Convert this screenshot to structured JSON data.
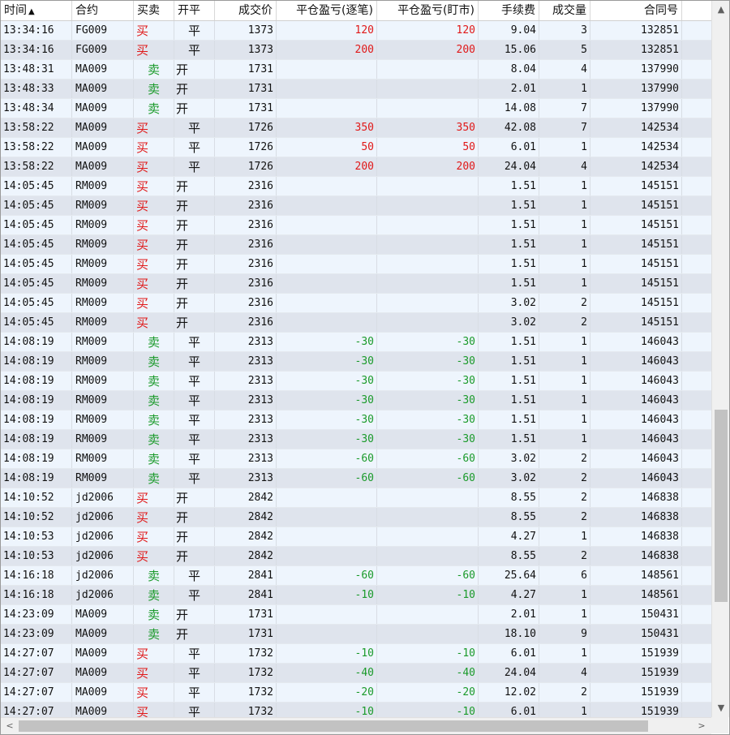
{
  "columns": {
    "time": "时间",
    "symbol": "合约",
    "direction": "买卖",
    "open_close": "开平",
    "price": "成交价",
    "pnl_trade": "平仓盈亏(逐笔)",
    "pnl_market": "平仓盈亏(盯市)",
    "fee": "手续费",
    "volume": "成交量",
    "order_no": "合同号",
    "sort_indicator": "▲"
  },
  "rows": [
    {
      "time": "13:34:16",
      "symbol": "FG009",
      "dir": "买",
      "oc": "平",
      "price": "1373",
      "pnl1": "120",
      "pnl2": "120",
      "fee": "9.04",
      "vol": "3",
      "order": "132851"
    },
    {
      "time": "13:34:16",
      "symbol": "FG009",
      "dir": "买",
      "oc": "平",
      "price": "1373",
      "pnl1": "200",
      "pnl2": "200",
      "fee": "15.06",
      "vol": "5",
      "order": "132851"
    },
    {
      "time": "13:48:31",
      "symbol": "MA009",
      "dir": "卖",
      "oc": "开",
      "price": "1731",
      "pnl1": "",
      "pnl2": "",
      "fee": "8.04",
      "vol": "4",
      "order": "137990"
    },
    {
      "time": "13:48:33",
      "symbol": "MA009",
      "dir": "卖",
      "oc": "开",
      "price": "1731",
      "pnl1": "",
      "pnl2": "",
      "fee": "2.01",
      "vol": "1",
      "order": "137990"
    },
    {
      "time": "13:48:34",
      "symbol": "MA009",
      "dir": "卖",
      "oc": "开",
      "price": "1731",
      "pnl1": "",
      "pnl2": "",
      "fee": "14.08",
      "vol": "7",
      "order": "137990"
    },
    {
      "time": "13:58:22",
      "symbol": "MA009",
      "dir": "买",
      "oc": "平",
      "price": "1726",
      "pnl1": "350",
      "pnl2": "350",
      "fee": "42.08",
      "vol": "7",
      "order": "142534"
    },
    {
      "time": "13:58:22",
      "symbol": "MA009",
      "dir": "买",
      "oc": "平",
      "price": "1726",
      "pnl1": "50",
      "pnl2": "50",
      "fee": "6.01",
      "vol": "1",
      "order": "142534"
    },
    {
      "time": "13:58:22",
      "symbol": "MA009",
      "dir": "买",
      "oc": "平",
      "price": "1726",
      "pnl1": "200",
      "pnl2": "200",
      "fee": "24.04",
      "vol": "4",
      "order": "142534"
    },
    {
      "time": "14:05:45",
      "symbol": "RM009",
      "dir": "买",
      "oc": "开",
      "price": "2316",
      "pnl1": "",
      "pnl2": "",
      "fee": "1.51",
      "vol": "1",
      "order": "145151"
    },
    {
      "time": "14:05:45",
      "symbol": "RM009",
      "dir": "买",
      "oc": "开",
      "price": "2316",
      "pnl1": "",
      "pnl2": "",
      "fee": "1.51",
      "vol": "1",
      "order": "145151"
    },
    {
      "time": "14:05:45",
      "symbol": "RM009",
      "dir": "买",
      "oc": "开",
      "price": "2316",
      "pnl1": "",
      "pnl2": "",
      "fee": "1.51",
      "vol": "1",
      "order": "145151"
    },
    {
      "time": "14:05:45",
      "symbol": "RM009",
      "dir": "买",
      "oc": "开",
      "price": "2316",
      "pnl1": "",
      "pnl2": "",
      "fee": "1.51",
      "vol": "1",
      "order": "145151"
    },
    {
      "time": "14:05:45",
      "symbol": "RM009",
      "dir": "买",
      "oc": "开",
      "price": "2316",
      "pnl1": "",
      "pnl2": "",
      "fee": "1.51",
      "vol": "1",
      "order": "145151"
    },
    {
      "time": "14:05:45",
      "symbol": "RM009",
      "dir": "买",
      "oc": "开",
      "price": "2316",
      "pnl1": "",
      "pnl2": "",
      "fee": "1.51",
      "vol": "1",
      "order": "145151"
    },
    {
      "time": "14:05:45",
      "symbol": "RM009",
      "dir": "买",
      "oc": "开",
      "price": "2316",
      "pnl1": "",
      "pnl2": "",
      "fee": "3.02",
      "vol": "2",
      "order": "145151"
    },
    {
      "time": "14:05:45",
      "symbol": "RM009",
      "dir": "买",
      "oc": "开",
      "price": "2316",
      "pnl1": "",
      "pnl2": "",
      "fee": "3.02",
      "vol": "2",
      "order": "145151"
    },
    {
      "time": "14:08:19",
      "symbol": "RM009",
      "dir": "卖",
      "oc": "平",
      "price": "2313",
      "pnl1": "-30",
      "pnl2": "-30",
      "fee": "1.51",
      "vol": "1",
      "order": "146043"
    },
    {
      "time": "14:08:19",
      "symbol": "RM009",
      "dir": "卖",
      "oc": "平",
      "price": "2313",
      "pnl1": "-30",
      "pnl2": "-30",
      "fee": "1.51",
      "vol": "1",
      "order": "146043"
    },
    {
      "time": "14:08:19",
      "symbol": "RM009",
      "dir": "卖",
      "oc": "平",
      "price": "2313",
      "pnl1": "-30",
      "pnl2": "-30",
      "fee": "1.51",
      "vol": "1",
      "order": "146043"
    },
    {
      "time": "14:08:19",
      "symbol": "RM009",
      "dir": "卖",
      "oc": "平",
      "price": "2313",
      "pnl1": "-30",
      "pnl2": "-30",
      "fee": "1.51",
      "vol": "1",
      "order": "146043"
    },
    {
      "time": "14:08:19",
      "symbol": "RM009",
      "dir": "卖",
      "oc": "平",
      "price": "2313",
      "pnl1": "-30",
      "pnl2": "-30",
      "fee": "1.51",
      "vol": "1",
      "order": "146043"
    },
    {
      "time": "14:08:19",
      "symbol": "RM009",
      "dir": "卖",
      "oc": "平",
      "price": "2313",
      "pnl1": "-30",
      "pnl2": "-30",
      "fee": "1.51",
      "vol": "1",
      "order": "146043"
    },
    {
      "time": "14:08:19",
      "symbol": "RM009",
      "dir": "卖",
      "oc": "平",
      "price": "2313",
      "pnl1": "-60",
      "pnl2": "-60",
      "fee": "3.02",
      "vol": "2",
      "order": "146043"
    },
    {
      "time": "14:08:19",
      "symbol": "RM009",
      "dir": "卖",
      "oc": "平",
      "price": "2313",
      "pnl1": "-60",
      "pnl2": "-60",
      "fee": "3.02",
      "vol": "2",
      "order": "146043"
    },
    {
      "time": "14:10:52",
      "symbol": "jd2006",
      "dir": "买",
      "oc": "开",
      "price": "2842",
      "pnl1": "",
      "pnl2": "",
      "fee": "8.55",
      "vol": "2",
      "order": "146838"
    },
    {
      "time": "14:10:52",
      "symbol": "jd2006",
      "dir": "买",
      "oc": "开",
      "price": "2842",
      "pnl1": "",
      "pnl2": "",
      "fee": "8.55",
      "vol": "2",
      "order": "146838"
    },
    {
      "time": "14:10:53",
      "symbol": "jd2006",
      "dir": "买",
      "oc": "开",
      "price": "2842",
      "pnl1": "",
      "pnl2": "",
      "fee": "4.27",
      "vol": "1",
      "order": "146838"
    },
    {
      "time": "14:10:53",
      "symbol": "jd2006",
      "dir": "买",
      "oc": "开",
      "price": "2842",
      "pnl1": "",
      "pnl2": "",
      "fee": "8.55",
      "vol": "2",
      "order": "146838"
    },
    {
      "time": "14:16:18",
      "symbol": "jd2006",
      "dir": "卖",
      "oc": "平",
      "price": "2841",
      "pnl1": "-60",
      "pnl2": "-60",
      "fee": "25.64",
      "vol": "6",
      "order": "148561"
    },
    {
      "time": "14:16:18",
      "symbol": "jd2006",
      "dir": "卖",
      "oc": "平",
      "price": "2841",
      "pnl1": "-10",
      "pnl2": "-10",
      "fee": "4.27",
      "vol": "1",
      "order": "148561"
    },
    {
      "time": "14:23:09",
      "symbol": "MA009",
      "dir": "卖",
      "oc": "开",
      "price": "1731",
      "pnl1": "",
      "pnl2": "",
      "fee": "2.01",
      "vol": "1",
      "order": "150431"
    },
    {
      "time": "14:23:09",
      "symbol": "MA009",
      "dir": "卖",
      "oc": "开",
      "price": "1731",
      "pnl1": "",
      "pnl2": "",
      "fee": "18.10",
      "vol": "9",
      "order": "150431"
    },
    {
      "time": "14:27:07",
      "symbol": "MA009",
      "dir": "买",
      "oc": "平",
      "price": "1732",
      "pnl1": "-10",
      "pnl2": "-10",
      "fee": "6.01",
      "vol": "1",
      "order": "151939"
    },
    {
      "time": "14:27:07",
      "symbol": "MA009",
      "dir": "买",
      "oc": "平",
      "price": "1732",
      "pnl1": "-40",
      "pnl2": "-40",
      "fee": "24.04",
      "vol": "4",
      "order": "151939"
    },
    {
      "time": "14:27:07",
      "symbol": "MA009",
      "dir": "买",
      "oc": "平",
      "price": "1732",
      "pnl1": "-20",
      "pnl2": "-20",
      "fee": "12.02",
      "vol": "2",
      "order": "151939"
    },
    {
      "time": "14:27:07",
      "symbol": "MA009",
      "dir": "买",
      "oc": "平",
      "price": "1732",
      "pnl1": "-10",
      "pnl2": "-10",
      "fee": "6.01",
      "vol": "1",
      "order": "151939"
    }
  ],
  "colors": {
    "buy": "#e01818",
    "sell": "#1a9a2a",
    "row_alt": "#dfe4ed",
    "row_normal": "#eef5fd"
  },
  "scrollbars": {
    "up_icon": "▲",
    "down_icon": "▼",
    "left_icon": "<",
    "right_icon": ">"
  }
}
